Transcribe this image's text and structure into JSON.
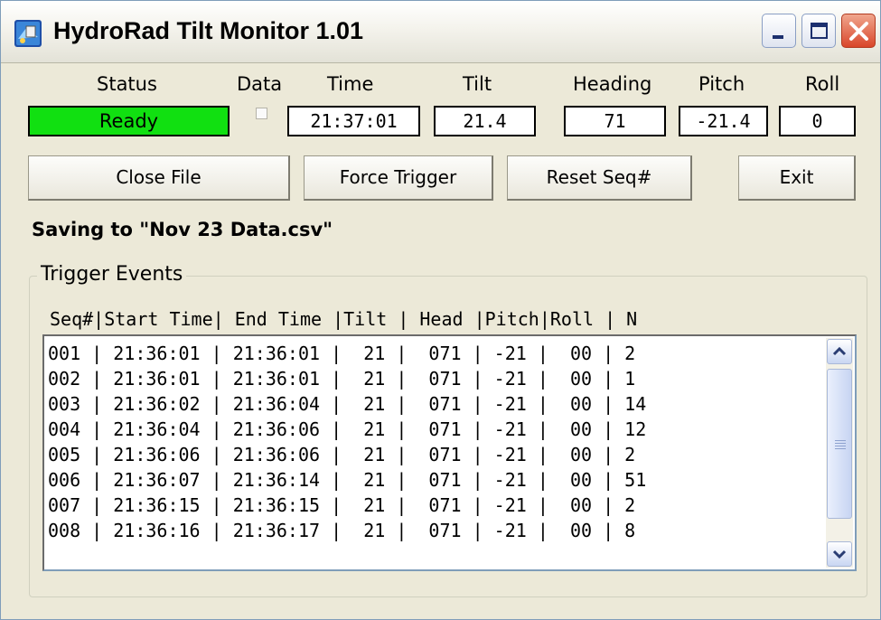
{
  "window": {
    "title": "HydroRad Tilt Monitor 1.01",
    "icons": {
      "app": "hydrorad-app-icon",
      "minimize": "minimize-icon",
      "maximize": "maximize-icon",
      "close": "close-icon"
    }
  },
  "headers": {
    "status": "Status",
    "data": "Data",
    "time": "Time",
    "tilt": "Tilt",
    "heading": "Heading",
    "pitch": "Pitch",
    "roll": "Roll"
  },
  "values": {
    "status": "Ready",
    "data_checked": false,
    "time": "21:37:01",
    "tilt": "21.4",
    "heading": "71",
    "pitch": "-21.4",
    "roll": "0"
  },
  "colors": {
    "status_ready": "#11e011",
    "window_bg": "#ece9d8"
  },
  "buttons": {
    "close_file": "Close File",
    "force_trigger": "Force Trigger",
    "reset_seq": "Reset Seq#",
    "exit": "Exit"
  },
  "saving_text": "Saving to \"Nov 23 Data.csv\"",
  "trigger_events": {
    "group_label": "Trigger Events",
    "column_header": "Seq#|Start Time| End Time |Tilt | Head |Pitch|Roll | N",
    "rows": [
      "001 | 21:36:01 | 21:36:01 |  21 |  071 | -21 |  00 | 2",
      "002 | 21:36:01 | 21:36:01 |  21 |  071 | -21 |  00 | 1",
      "003 | 21:36:02 | 21:36:04 |  21 |  071 | -21 |  00 | 14",
      "004 | 21:36:04 | 21:36:06 |  21 |  071 | -21 |  00 | 12",
      "005 | 21:36:06 | 21:36:06 |  21 |  071 | -21 |  00 | 2",
      "006 | 21:36:07 | 21:36:14 |  21 |  071 | -21 |  00 | 51",
      "007 | 21:36:15 | 21:36:15 |  21 |  071 | -21 |  00 | 2",
      "008 | 21:36:16 | 21:36:17 |  21 |  071 | -21 |  00 | 8"
    ]
  }
}
